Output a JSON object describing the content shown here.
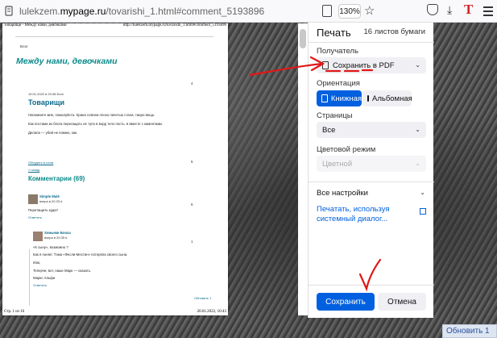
{
  "browser": {
    "url_prefix": "lulekzem.",
    "url_domain": "mypage.ru",
    "url_path": "/tovarishi_1.html#comment_5193896",
    "zoom": "130%"
  },
  "preview": {
    "header_left": "Товарищи - Между нами, девочками",
    "header_right": "http://lulekzem.mypage.ru/tovarishi_1.html#comment_5193896",
    "blog_link": "Блог",
    "blog_title": "Между нами, девочками",
    "post_num": "4",
    "post_meta": "19.01.2022 в 20:38   Блог",
    "post_title": "Товарищи",
    "post_line1": "Напомните мне, пожалуйста. Хрaна совсем плохо пачетью стала.  такую вещь:",
    "post_line2": "Как постами из блога перегащать не тупо в ворд тело пость. в вместе с каментами.",
    "post_line3": "Делала — убей не помню, как.",
    "discuss_link": "Обсудить в соом",
    "nav_link": "« назад",
    "num5": "5",
    "num6": "6",
    "comments_title": "Комментарии (69)",
    "c1_name": "Simple Malé",
    "c1_meta": "вчера в 20:33 #",
    "c1_text": "Перетащить куда?",
    "c1_reply": "Ответить",
    "c2_num": "1",
    "c2_name": "Хомьяки Блоха",
    "c2_meta": "вчера в 20:35 #",
    "c2_l1": "«К сыну», возможно ?",
    "c2_l2": "Как я понял: Тэма «Фесли-Местин» потеряла своего сына.",
    "c2_l3": "Изю,",
    "c2_l4": "Теперчи, вот, наше Марк — сказать.",
    "c2_l5": "Маркс Альфи",
    "c2_reply": "Ответить",
    "update_link": "Обновить 1",
    "footer_left": "Стр. 1 из 16",
    "footer_right": "20.01.2022, 10:43"
  },
  "print_panel": {
    "title": "Печать",
    "sheets": "16 листов бумаги",
    "printer_label": "Получатель",
    "printer_value": "Сохранить в PDF",
    "orientation_label": "Ориентация",
    "portrait": "Книжная",
    "landscape": "Альбомная",
    "pages_label": "Страницы",
    "pages_value": "Все",
    "color_label": "Цветовой режим",
    "color_value": "Цветной",
    "more_settings": "Все настройки",
    "system_dialog": "Печатать, используя системный диалог...",
    "save_button": "Сохранить",
    "cancel_button": "Отмена"
  },
  "corner_button": "Обновить 1",
  "colors": {
    "accent": "#0060df",
    "teal_title": "#0c8a8a",
    "ink_red": "#e01818"
  }
}
